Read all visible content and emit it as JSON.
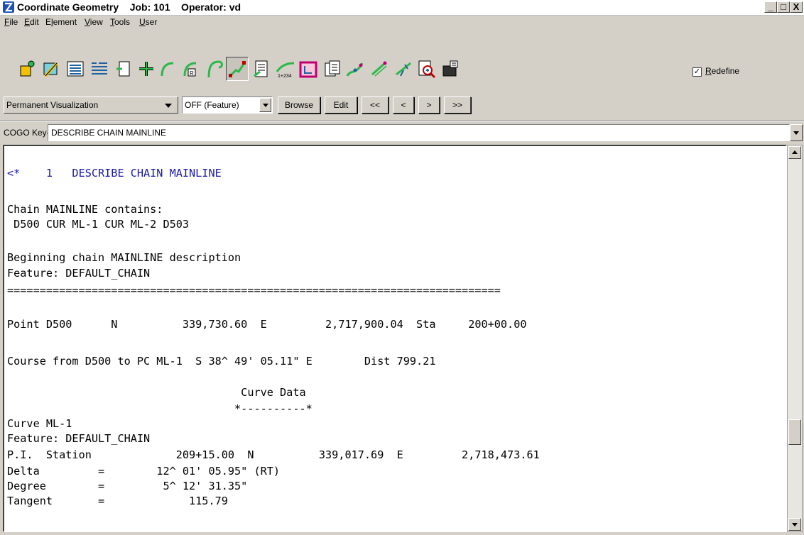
{
  "window": {
    "title": "Coordinate Geometry    Job: 101    Operator: vd",
    "controls": {
      "minimize": "_",
      "maximize": "□",
      "close": "X"
    }
  },
  "menu": [
    {
      "label": "File",
      "u": "F",
      "rest": "ile"
    },
    {
      "label": "Edit",
      "u": "E",
      "rest": "dit"
    },
    {
      "label": "Element",
      "u": "",
      "pre": "E",
      "u2": "l",
      "rest": "ement"
    },
    {
      "label": "View",
      "u": "V",
      "rest": "iew"
    },
    {
      "label": "Tools",
      "u": "T",
      "rest": "ools"
    },
    {
      "label": "User",
      "u": "U",
      "rest": "ser"
    }
  ],
  "toolbar": {
    "tools": [
      "key-in-icon",
      "edit-icon",
      "list-icon",
      "report-icon",
      "store-icon",
      "point-icon",
      "curve-icon",
      "curve-radius-icon",
      "spiral-icon",
      "chain-icon",
      "chain-list-icon",
      "stationing-icon",
      "parcel-icon",
      "parcel-list-icon",
      "profile-icon",
      "transform-icon",
      "traverse-icon",
      "navigator-icon",
      "visualize-icon"
    ],
    "active_tool": "chain-icon",
    "redefine_label": "Redefine",
    "redefine_checked": true
  },
  "controls": {
    "visualization": "Permanent Visualization",
    "feature": "OFF (Feature)",
    "browse": "Browse",
    "edit": "Edit",
    "first": "<<",
    "prev": "<",
    "next": ">",
    "last": ">>"
  },
  "keyin": {
    "label": "COGO Key-in",
    "value": "DESCRIBE CHAIN MAINLINE"
  },
  "output": {
    "lines": [
      {
        "text": "<*    1   DESCRIBE CHAIN MAINLINE",
        "color": "blue"
      },
      {
        "text": ""
      },
      {
        "text": "Chain MAINLINE contains:"
      },
      {
        "text": " D500 CUR ML-1 CUR ML-2 D503"
      },
      {
        "text": ""
      },
      {
        "text": "Beginning chain MAINLINE description"
      },
      {
        "text": "Feature: DEFAULT_CHAIN"
      },
      {
        "text": "============================================================================"
      },
      {
        "text": ""
      },
      {
        "text": "Point D500      N          339,730.60  E         2,717,900.04  Sta     200+00.00"
      },
      {
        "text": ""
      },
      {
        "text": "Course from D500 to PC ML-1  S 38^ 49' 05.11\" E        Dist 799.21"
      },
      {
        "text": ""
      },
      {
        "text": "                                    Curve Data"
      },
      {
        "text": "                                   *----------*"
      },
      {
        "text": "Curve ML-1"
      },
      {
        "text": "Feature: DEFAULT_CHAIN"
      },
      {
        "text": "P.I.  Station             209+15.00  N          339,017.69  E         2,718,473.61"
      },
      {
        "text": "Delta         =        12^ 01' 05.95\" (RT)"
      },
      {
        "text": "Degree        =         5^ 12' 31.35\""
      },
      {
        "text": "Tangent       =             115.79"
      }
    ]
  }
}
